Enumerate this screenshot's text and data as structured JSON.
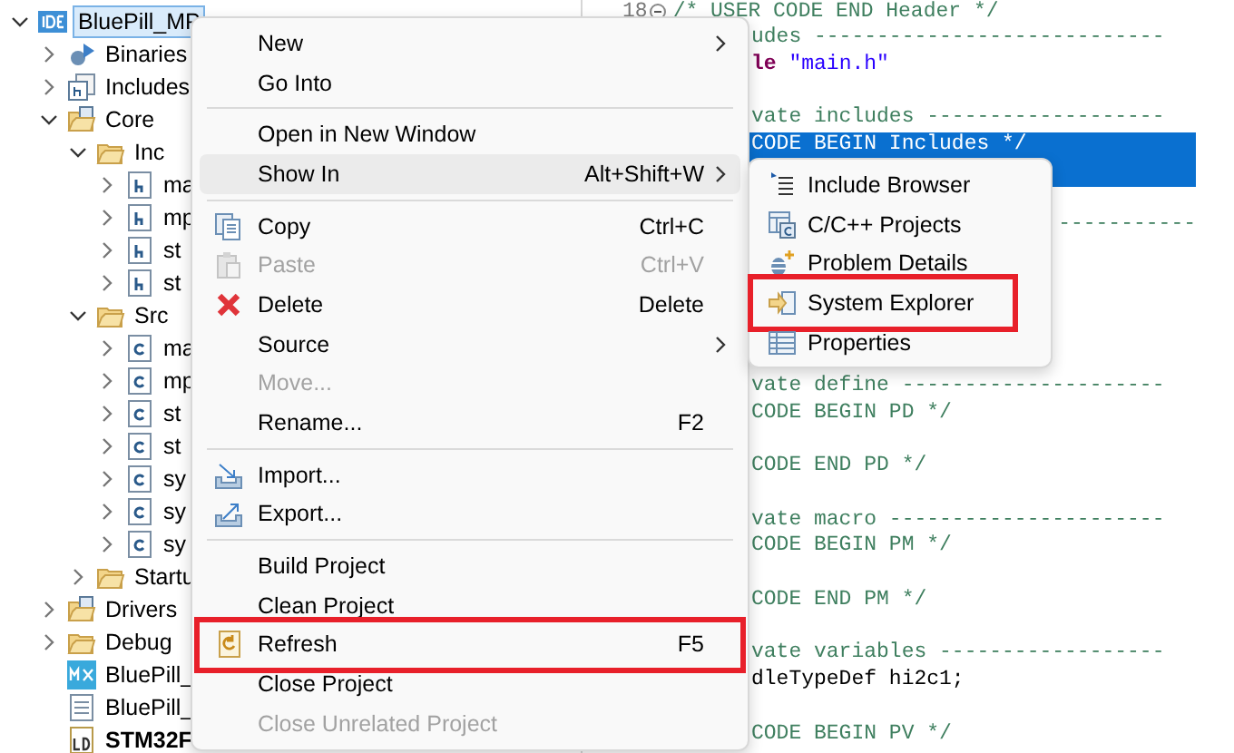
{
  "tree": [
    {
      "label": "BluePill_MP",
      "kind": "project",
      "expanded": true,
      "selected": true,
      "children": [
        {
          "label": "Binaries",
          "kind": "binaries",
          "expanded": false,
          "selected": false
        },
        {
          "label": "Includes",
          "kind": "includes",
          "expanded": false,
          "selected": false
        },
        {
          "label": "Core",
          "kind": "src-folder",
          "expanded": true,
          "selected": false,
          "children": [
            {
              "label": "Inc",
              "kind": "folder",
              "expanded": true,
              "selected": false,
              "children": [
                {
                  "label": "ma",
                  "kind": "h-file",
                  "expanded": false,
                  "selected": false
                },
                {
                  "label": "mp",
                  "kind": "h-file",
                  "expanded": false,
                  "selected": false
                },
                {
                  "label": "st",
                  "kind": "h-file",
                  "expanded": false,
                  "selected": false
                },
                {
                  "label": "st",
                  "kind": "h-file",
                  "expanded": false,
                  "selected": false
                }
              ]
            },
            {
              "label": "Src",
              "kind": "folder",
              "expanded": true,
              "selected": false,
              "children": [
                {
                  "label": "ma",
                  "kind": "c-file",
                  "expanded": false,
                  "selected": false
                },
                {
                  "label": "mp",
                  "kind": "c-file",
                  "expanded": false,
                  "selected": false
                },
                {
                  "label": "st",
                  "kind": "c-file",
                  "expanded": false,
                  "selected": false
                },
                {
                  "label": "st",
                  "kind": "c-file",
                  "expanded": false,
                  "selected": false
                },
                {
                  "label": "sy",
                  "kind": "c-file",
                  "expanded": false,
                  "selected": false
                },
                {
                  "label": "sy",
                  "kind": "c-file",
                  "expanded": false,
                  "selected": false
                },
                {
                  "label": "sy",
                  "kind": "c-file",
                  "expanded": false,
                  "selected": false
                }
              ]
            },
            {
              "label": "Startu",
              "kind": "folder",
              "expanded": false,
              "selected": false
            }
          ]
        },
        {
          "label": "Drivers",
          "kind": "src-folder",
          "expanded": false,
          "selected": false
        },
        {
          "label": "Debug",
          "kind": "folder",
          "expanded": false,
          "selected": false
        },
        {
          "label": "BluePill_",
          "kind": "mx-file",
          "selected": false
        },
        {
          "label": "BluePill_",
          "kind": "text-file",
          "selected": false
        },
        {
          "label": "STM32F",
          "kind": "ld-file",
          "selected": false
        }
      ]
    }
  ],
  "editor": {
    "header": {
      "line_number": "18",
      "text": "/* USER CODE END Header */"
    },
    "lines": [
      {
        "selected": false,
        "segments": [
          {
            "kind": "comment",
            "text": "udes ----------------------------"
          }
        ]
      },
      {
        "selected": false,
        "segments": [
          {
            "kind": "keyword",
            "text": "le "
          },
          {
            "kind": "string",
            "text": "\"main.h\""
          }
        ]
      },
      {
        "selected": false
      },
      {
        "selected": false,
        "segments": [
          {
            "kind": "comment",
            "text": "vate includes -------------------"
          }
        ]
      },
      {
        "selected": true,
        "segments": [
          {
            "kind": "comment",
            "text": "CODE BEGIN Includes */"
          }
        ]
      },
      {
        "selected": true
      },
      {
        "selected": false
      },
      {
        "selected": false,
        "segments": [
          {
            "kind": "rule",
            "text": "-----------"
          }
        ]
      },
      {
        "selected": false
      },
      {
        "selected": false
      },
      {
        "selected": false
      },
      {
        "selected": false
      },
      {
        "selected": false
      },
      {
        "selected": false,
        "segments": [
          {
            "kind": "comment",
            "text": "vate define ---------------------"
          }
        ]
      },
      {
        "selected": false,
        "segments": [
          {
            "kind": "comment",
            "text": "CODE BEGIN PD */"
          }
        ]
      },
      {
        "selected": false
      },
      {
        "selected": false,
        "segments": [
          {
            "kind": "comment",
            "text": "CODE END PD */"
          }
        ]
      },
      {
        "selected": false
      },
      {
        "selected": false,
        "segments": [
          {
            "kind": "comment",
            "text": "vate macro ----------------------"
          }
        ]
      },
      {
        "selected": false,
        "segments": [
          {
            "kind": "comment",
            "text": "CODE BEGIN PM */"
          }
        ]
      },
      {
        "selected": false
      },
      {
        "selected": false,
        "segments": [
          {
            "kind": "comment",
            "text": "CODE END PM */"
          }
        ]
      },
      {
        "selected": false
      },
      {
        "selected": false,
        "segments": [
          {
            "kind": "comment",
            "text": "vate variables ------------------"
          }
        ]
      },
      {
        "selected": false,
        "segments": [
          {
            "kind": "code",
            "text": "dleTypeDef hi2c1;"
          }
        ]
      },
      {
        "selected": false
      },
      {
        "selected": false,
        "segments": [
          {
            "kind": "comment",
            "text": "CODE BEGIN PV */"
          }
        ]
      }
    ]
  },
  "context_menu": [
    {
      "kind": "item",
      "label": "New",
      "submenu": true,
      "disabled": false,
      "selected": false,
      "annotated": false
    },
    {
      "kind": "item",
      "label": "Go Into",
      "submenu": false,
      "disabled": false,
      "selected": false,
      "annotated": false
    },
    {
      "kind": "separator"
    },
    {
      "kind": "item",
      "label": "Open in New Window",
      "submenu": false,
      "disabled": false,
      "selected": false,
      "annotated": false
    },
    {
      "kind": "item",
      "label": "Show In",
      "shortcut": "Alt+Shift+W",
      "submenu": true,
      "disabled": false,
      "selected": true,
      "annotated": false
    },
    {
      "kind": "separator"
    },
    {
      "kind": "copy",
      "label": "Copy",
      "shortcut": "Ctrl+C",
      "submenu": false,
      "disabled": false,
      "selected": false,
      "annotated": false
    },
    {
      "kind": "paste",
      "label": "Paste",
      "shortcut": "Ctrl+V",
      "submenu": false,
      "disabled": true,
      "selected": false,
      "annotated": false
    },
    {
      "kind": "delete",
      "label": "Delete",
      "shortcut": "Delete",
      "submenu": false,
      "disabled": false,
      "selected": false,
      "annotated": false
    },
    {
      "kind": "item",
      "label": "Source",
      "submenu": true,
      "disabled": false,
      "selected": false,
      "annotated": false
    },
    {
      "kind": "item",
      "label": "Move...",
      "submenu": false,
      "disabled": true,
      "selected": false,
      "annotated": false
    },
    {
      "kind": "item",
      "label": "Rename...",
      "shortcut": "F2",
      "submenu": false,
      "disabled": false,
      "selected": false,
      "annotated": false
    },
    {
      "kind": "separator"
    },
    {
      "kind": "import",
      "label": "Import...",
      "submenu": false,
      "disabled": false,
      "selected": false,
      "annotated": false
    },
    {
      "kind": "export",
      "label": "Export...",
      "submenu": false,
      "disabled": false,
      "selected": false,
      "annotated": false
    },
    {
      "kind": "separator"
    },
    {
      "kind": "item",
      "label": "Build Project",
      "submenu": false,
      "disabled": false,
      "selected": false,
      "annotated": false
    },
    {
      "kind": "item",
      "label": "Clean Project",
      "submenu": false,
      "disabled": false,
      "selected": false,
      "annotated": false
    },
    {
      "kind": "refresh",
      "label": "Refresh",
      "shortcut": "F5",
      "submenu": false,
      "disabled": false,
      "selected": false,
      "annotated": true
    },
    {
      "kind": "item",
      "label": "Close Project",
      "submenu": false,
      "disabled": false,
      "selected": false,
      "annotated": false
    },
    {
      "kind": "item",
      "label": "Close Unrelated Project",
      "submenu": false,
      "disabled": true,
      "selected": false,
      "annotated": false
    }
  ],
  "show_in_submenu": [
    {
      "kind": "include-browser",
      "label": "Include Browser",
      "annotated": false
    },
    {
      "kind": "projects",
      "label": "C/C++ Projects",
      "annotated": false
    },
    {
      "kind": "problem",
      "label": "Problem Details",
      "annotated": false
    },
    {
      "kind": "explorer",
      "label": "System Explorer",
      "annotated": true
    },
    {
      "kind": "properties",
      "label": "Properties",
      "annotated": false
    }
  ]
}
